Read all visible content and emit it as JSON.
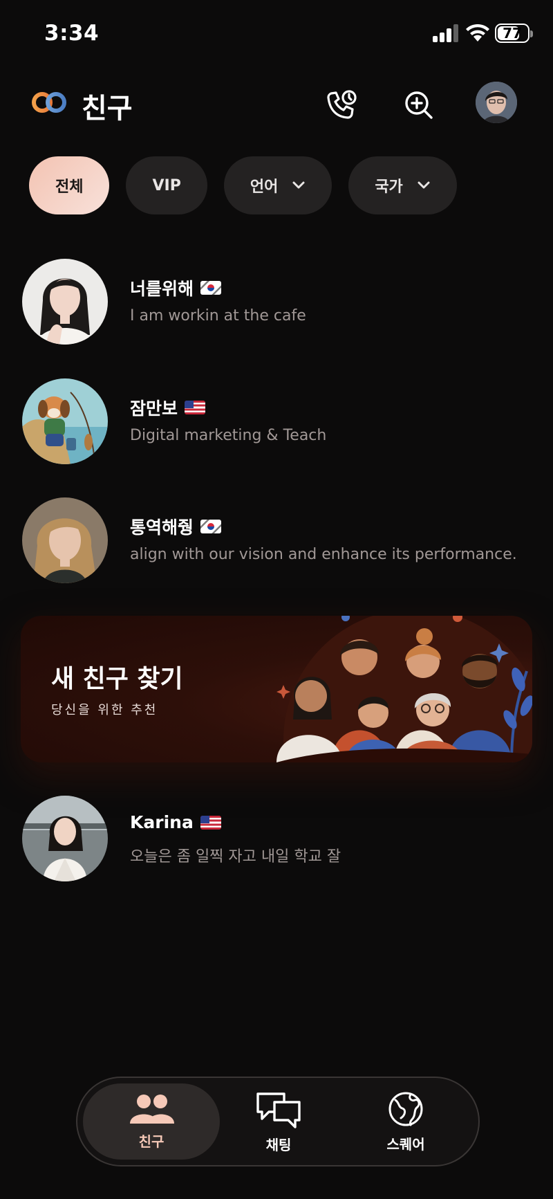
{
  "status_bar": {
    "time": "3:34",
    "battery": "77",
    "battery_level": 0.77
  },
  "header": {
    "title": "친구",
    "icons": [
      "logo-icon",
      "call-history-icon",
      "add-friend-search-icon",
      "profile-avatar"
    ]
  },
  "filters": [
    {
      "label": "전체",
      "active": true,
      "dropdown": false
    },
    {
      "label": "VIP",
      "active": false,
      "dropdown": false
    },
    {
      "label": "언어",
      "active": false,
      "dropdown": true
    },
    {
      "label": "국가",
      "active": false,
      "dropdown": true
    }
  ],
  "friends": [
    {
      "name": "너를위해",
      "flag": "kr",
      "message": "I am workin at the cafe"
    },
    {
      "name": "잠만보",
      "flag": "us",
      "message": "Digital marketing & Teach"
    },
    {
      "name": "통역해줭",
      "flag": "kr",
      "message": "align with our vision and enhance its performance."
    },
    {
      "name": "Karina",
      "flag": "us",
      "message": "오늘은 좀 일찍 자고 내일 학교 잘"
    }
  ],
  "banner": {
    "title": "새 친구 찾기",
    "subtitle": "당신을 위한 추천"
  },
  "nav": [
    {
      "label": "친구",
      "icon": "friends-icon",
      "active": true
    },
    {
      "label": "채팅",
      "icon": "chat-icon",
      "active": false
    },
    {
      "label": "스퀘어",
      "icon": "globe-icon",
      "active": false
    }
  ],
  "colors": {
    "background": "#0c0b0b",
    "accent": "#f6c9b8",
    "chip": "#242222",
    "muted_text": "#a19896"
  }
}
